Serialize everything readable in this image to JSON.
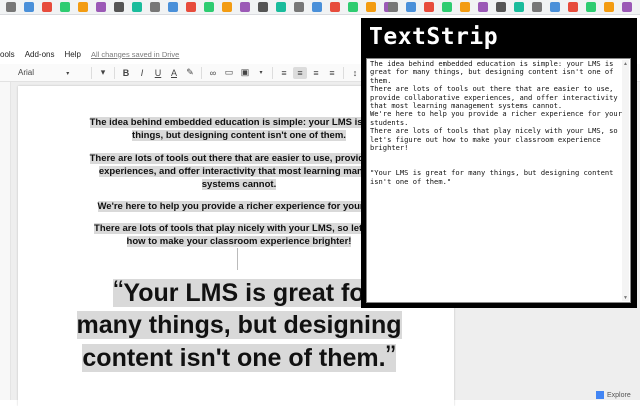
{
  "colors": {
    "popup_bg": "#000000",
    "highlight": "#d9d9d9",
    "accent": "#4285f4"
  },
  "menu": {
    "tools_label": "ools",
    "addons_label": "Add-ons",
    "help_label": "Help",
    "saved_status": "All changes saved in Drive"
  },
  "toolbar": {
    "font_name": "Arial",
    "font_dropdown_icon": "chevron-down-icon",
    "bold": "B",
    "italic": "I",
    "underline": "U",
    "text_color": "A"
  },
  "doc": {
    "p1_line1": "The idea behind embedded education is simple: your LMS is great",
    "p1_line2": "things, but designing content isn't one of them.",
    "p2_line1": "There are lots of tools out there that are easier to use, provide coll",
    "p2_line2": "experiences, and offer interactivity that most learning manage",
    "p2_line3": "systems cannot.",
    "p3_line1": "We're here to help you provide a richer experience for your stu",
    "p4_line1": "There are lots of tools that play nicely with your LMS, so let's fig",
    "p4_line2": "how to make your classroom experience brighter!",
    "quote_open": "“",
    "quote_line1": "Your LMS is great fo",
    "quote_line2": "many things, but designing",
    "quote_line3": "content isn't one of them.",
    "quote_close": "”"
  },
  "explore_label": "Explore",
  "popup": {
    "title": "TextStrip",
    "text": "The idea behind embedded education is simple: your LMS is\ngreat for many things, but designing content isn't one of\nthem.\nThere are lots of tools out there that are easier to use,\nprovide collaborative experiences, and offer interactivity\nthat most learning management systems cannot.\nWe're here to help you provide a richer experience for your\nstudents.\nThere are lots of tools that play nicely with your LMS, so\nlet's figure out how to make your classroom experience\nbrighter!\n\n\n\"Your LMS is great for many things, but designing content\nisn't one of them.\""
  },
  "extensions": {
    "left_icons": [
      "extension-icon",
      "extension-icon",
      "extension-icon",
      "extension-icon",
      "extension-icon",
      "extension-icon",
      "extension-icon",
      "extension-icon",
      "extension-icon",
      "extension-icon",
      "extension-icon",
      "extension-icon",
      "extension-icon",
      "extension-icon",
      "extension-icon",
      "extension-icon",
      "extension-icon",
      "extension-icon",
      "extension-icon",
      "extension-icon",
      "extension-icon",
      "extension-icon"
    ],
    "right_icons": [
      "pin-icon",
      "shield-icon",
      "gmail-icon",
      "camera-icon",
      "square-icon",
      "gmail-icon",
      "record-icon",
      "chrome-icon",
      "cloud-icon",
      "textstrip-icon",
      "lastpass-icon",
      "extension-icon",
      "facebook-icon",
      "chrome-icon"
    ]
  }
}
